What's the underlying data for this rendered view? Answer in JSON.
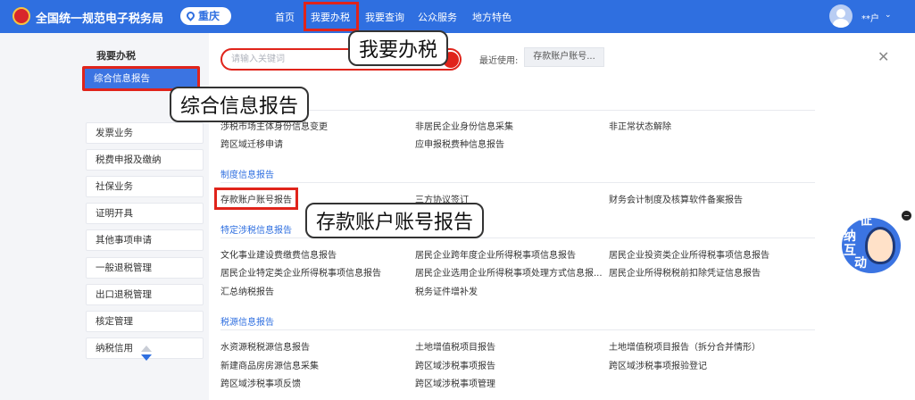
{
  "header": {
    "site_title": "全国统一规范电子税务局",
    "region": "重庆",
    "nav": [
      "首页",
      "我要办税",
      "我要查询",
      "公众服务",
      "地方特色"
    ],
    "user": "**户"
  },
  "sidebar": {
    "title": "我要办税",
    "items": [
      "综合信息报告",
      "发票业务",
      "税费申报及缴纳",
      "社保业务",
      "证明开具",
      "其他事项申请",
      "一般退税管理",
      "出口退税管理",
      "核定管理",
      "纳税信用"
    ]
  },
  "search": {
    "placeholder": "请输入关键词",
    "recent_label": "最近使用:",
    "recent_item": "存款账户账号..."
  },
  "sections": {
    "first_rows": [
      [
        "涉税市场主体身份信息变更",
        "非居民企业身份信息采集",
        "非正常状态解除"
      ],
      [
        "跨区域迁移申请",
        "应申报税费种信息报告",
        ""
      ]
    ],
    "zhidu": {
      "title": "制度信息报告",
      "rows": [
        [
          "存款账户账号报告",
          "三方协议签订",
          "财务会计制度及核算软件备案报告"
        ]
      ]
    },
    "tedingshe": {
      "title": "特定涉税信息报告",
      "rows": [
        [
          "文化事业建设费缴费信息报告",
          "居民企业跨年度企业所得税事项信息报告",
          "居民企业投资类企业所得税事项信息报告"
        ],
        [
          "居民企业特定类企业所得税事项信息报告",
          "居民企业选用企业所得税事项处理方式信息报...",
          "居民企业所得税税前扣除凭证信息报告"
        ],
        [
          "汇总纳税报告",
          "税务证件增补发",
          ""
        ]
      ]
    },
    "shuiyuan": {
      "title": "税源信息报告",
      "rows": [
        [
          "水资源税税源信息报告",
          "土地增值税项目报告",
          "土地增值税项目报告（拆分合并情形）"
        ],
        [
          "新建商品房房源信息采集",
          "跨区域涉税事项报告",
          "跨区域涉税事项报验登记"
        ],
        [
          "跨区域涉税事项反馈",
          "跨区域涉税事项管理",
          ""
        ]
      ]
    }
  },
  "callouts": {
    "nav": "我要办税",
    "sidebar": "综合信息报告",
    "link": "存款账户账号报告"
  },
  "mascot": {
    "chars": [
      "征",
      "纳",
      "互",
      "动"
    ]
  },
  "colors": {
    "brand": "#2f6fe0",
    "highlight": "#e0241b"
  }
}
